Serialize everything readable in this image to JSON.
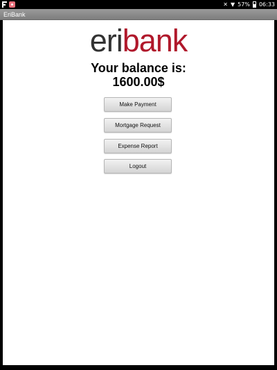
{
  "status_bar": {
    "battery": "57%",
    "time": "06:33",
    "icons": [
      "flipboard-icon",
      "app-notification-icon",
      "mute-icon",
      "wifi-icon",
      "battery-icon"
    ]
  },
  "app": {
    "title": "EriBank"
  },
  "logo": {
    "part1": "eri",
    "part2": "bank",
    "colors": {
      "part1": "#333333",
      "part2": "#b0182b"
    }
  },
  "balance": {
    "label": "Your balance is:",
    "amount": "1600.00$"
  },
  "buttons": {
    "make_payment": "Make Payment",
    "mortgage_request": "Mortgage Request",
    "expense_report": "Expense Report",
    "logout": "Logout"
  }
}
